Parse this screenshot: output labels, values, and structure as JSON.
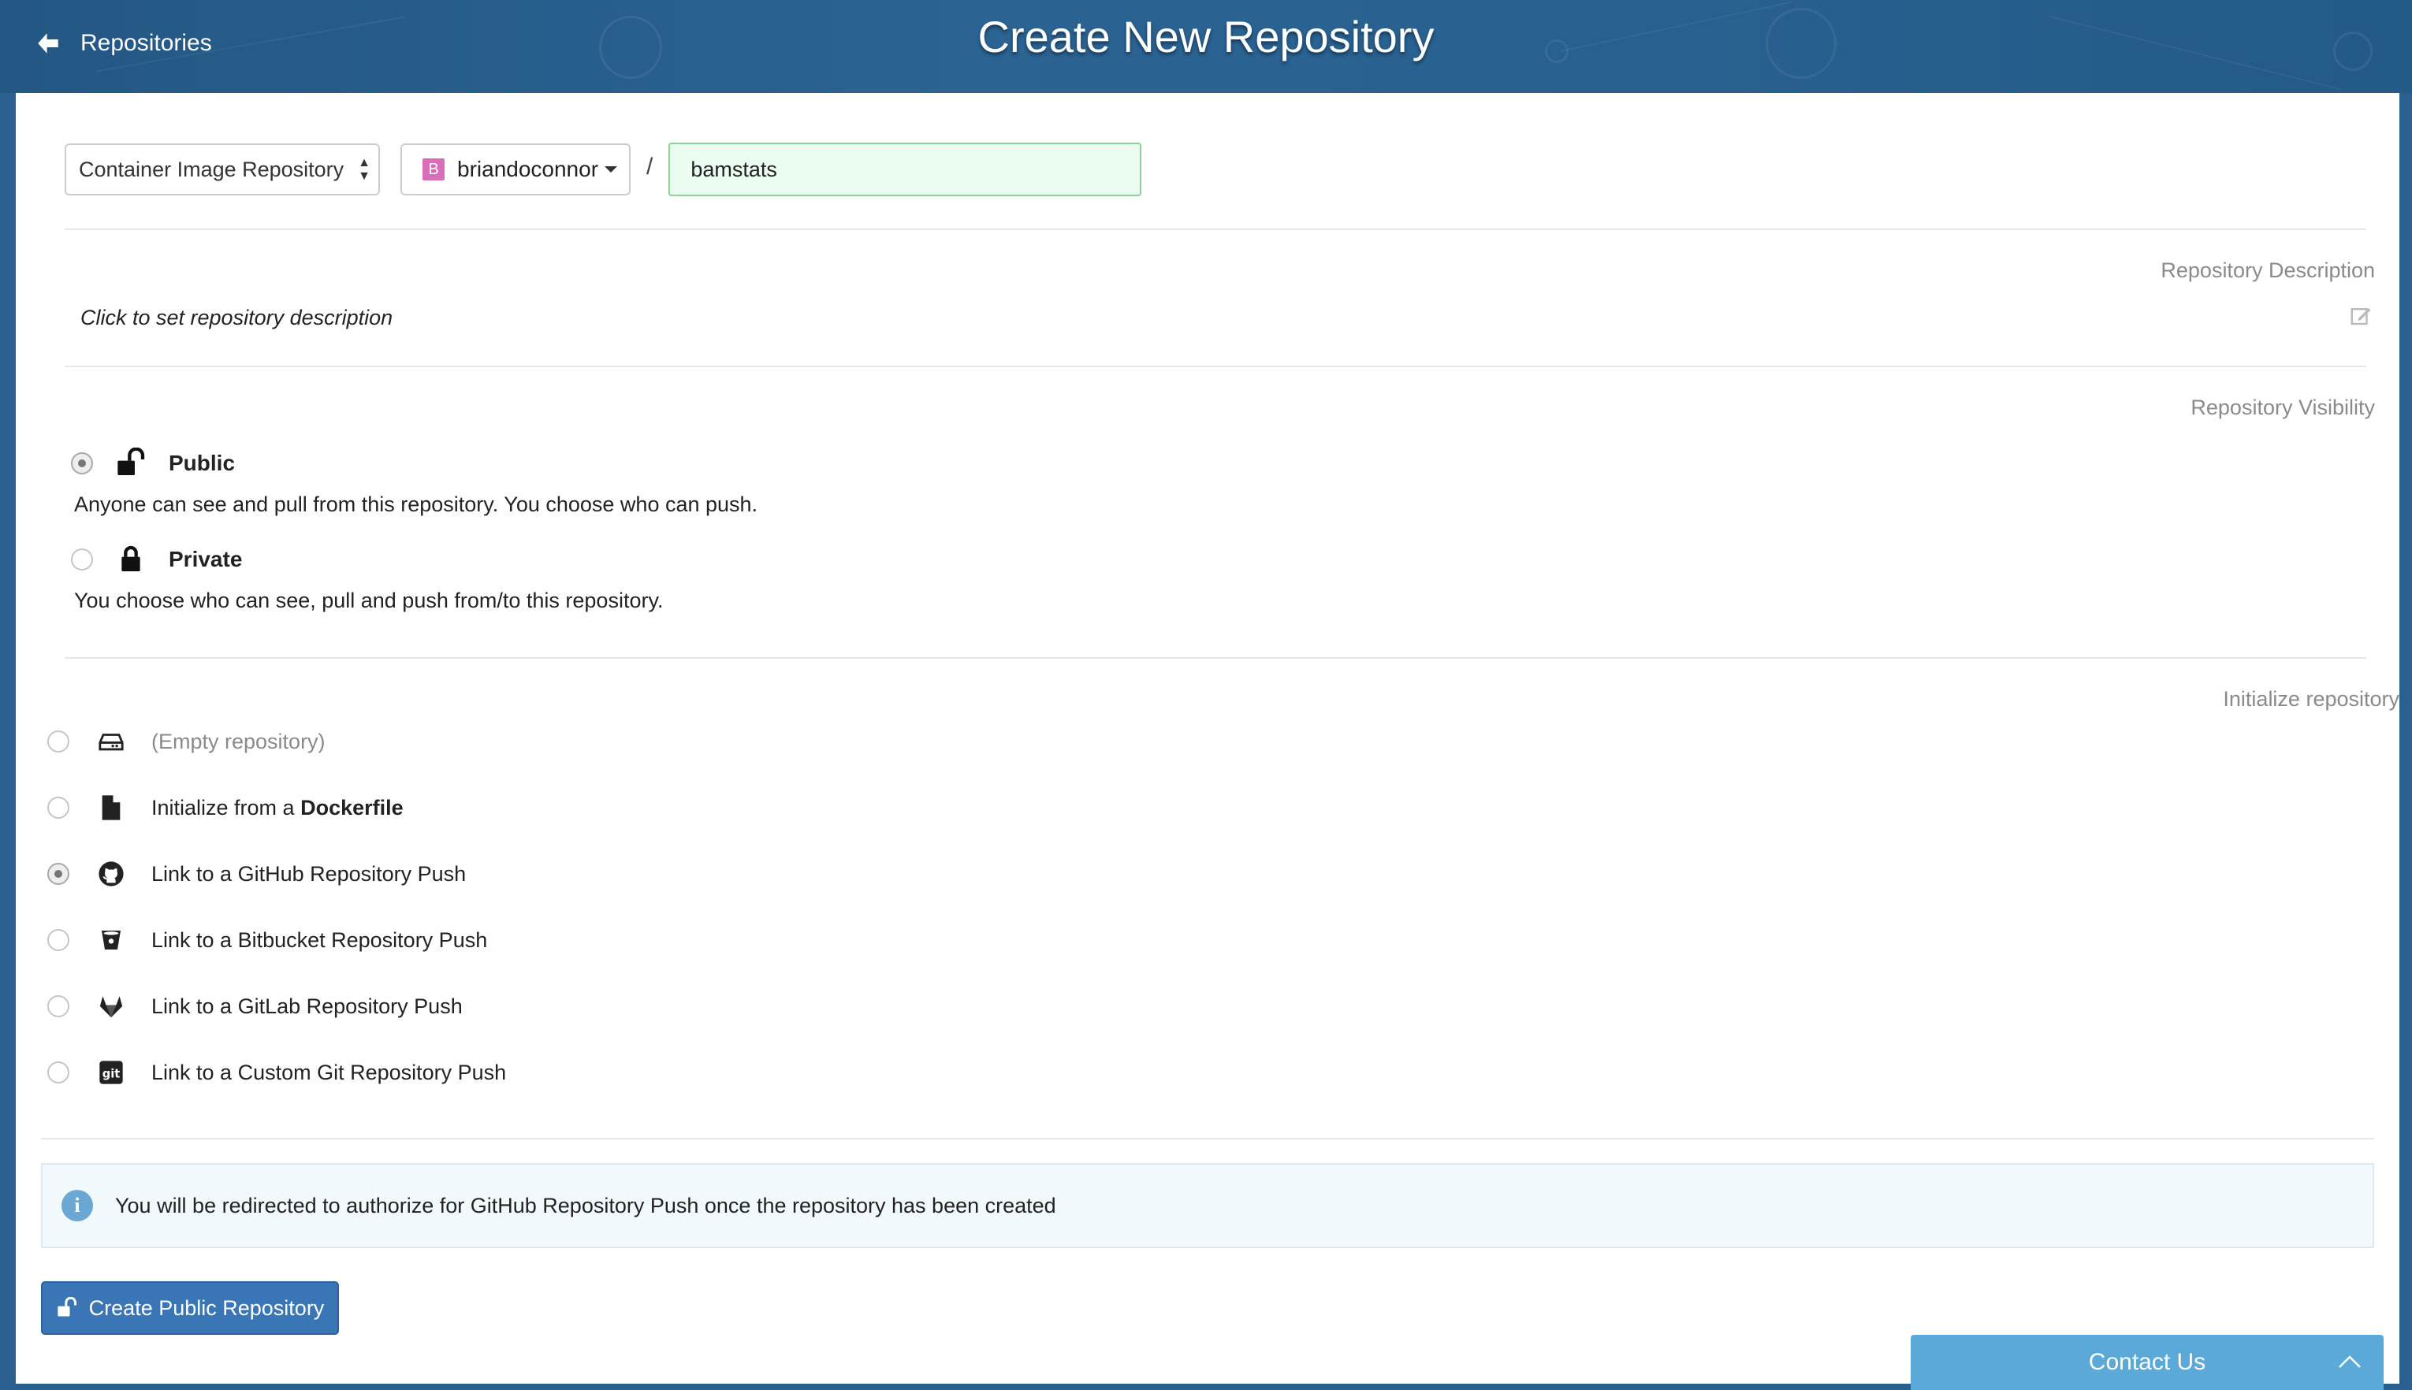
{
  "header": {
    "back_label": "Repositories",
    "title": "Create New Repository"
  },
  "form": {
    "kind_select_value": "Container Image Repository",
    "namespace_initial": "B",
    "namespace": "briandoconnor",
    "separator": "/",
    "repo_name_value": "bamstats"
  },
  "description": {
    "section_label": "Repository Description",
    "placeholder_text": "Click to set repository description"
  },
  "visibility": {
    "section_label": "Repository Visibility",
    "options": [
      {
        "label": "Public",
        "description": "Anyone can see and pull from this repository. You choose who can push.",
        "selected": true,
        "icon": "unlock-icon"
      },
      {
        "label": "Private",
        "description": "You choose who can see, pull and push from/to this repository.",
        "selected": false,
        "icon": "lock-icon"
      }
    ]
  },
  "initialize": {
    "section_label": "Initialize repository",
    "options": [
      {
        "label": "(Empty repository)",
        "selected": false,
        "icon": "hdd-icon"
      },
      {
        "label_prefix": "Initialize from a ",
        "label_bold": "Dockerfile",
        "selected": false,
        "icon": "file-icon"
      },
      {
        "label": "Link to a GitHub Repository Push",
        "selected": true,
        "icon": "github-icon"
      },
      {
        "label": "Link to a Bitbucket Repository Push",
        "selected": false,
        "icon": "bitbucket-icon"
      },
      {
        "label": "Link to a GitLab Repository Push",
        "selected": false,
        "icon": "gitlab-icon"
      },
      {
        "label": "Link to a Custom Git Repository Push",
        "selected": false,
        "icon": "git-icon"
      }
    ]
  },
  "info": {
    "icon_glyph": "i",
    "message": "You will be redirected to authorize for GitHub Repository Push once the repository has been created"
  },
  "create_button_label": "Create Public Repository",
  "contact_label": "Contact Us",
  "colors": {
    "header_bg": "#2a5f8f",
    "primary_button": "#3a76b6",
    "name_input_bg": "#ebfdf0",
    "contact_bar": "#5aa9d9",
    "info_icon": "#6aa8d3"
  }
}
